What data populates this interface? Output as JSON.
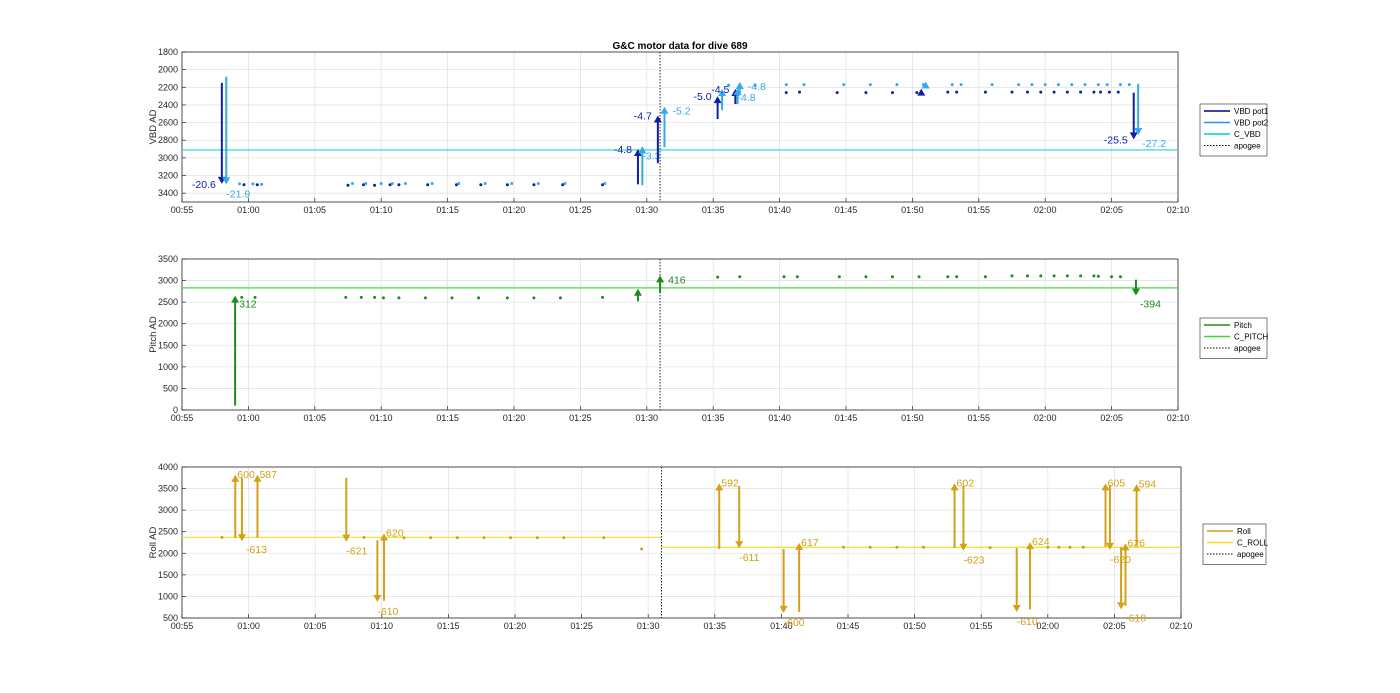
{
  "chart_data": [
    {
      "id": "vbd",
      "type": "line",
      "title": "G&C motor data for dive 689",
      "ylabel": "VBD AD",
      "ylim": [
        1800,
        3500
      ],
      "yreverse": true,
      "yticks": [
        1800,
        2000,
        2200,
        2400,
        2600,
        2800,
        3000,
        3200,
        3400
      ],
      "xlim": [
        "00:55",
        "02:10"
      ],
      "xticks": [
        "00:55",
        "01:00",
        "01:05",
        "01:10",
        "01:15",
        "01:20",
        "01:25",
        "01:30",
        "01:35",
        "01:40",
        "01:45",
        "01:50",
        "01:55",
        "02:00",
        "02:05",
        "02:10"
      ],
      "grid": true,
      "legend": {
        "placement": "right",
        "entries": [
          {
            "name": "VBD pot1",
            "color": "#00008b",
            "style": "solid"
          },
          {
            "name": "VBD pot2",
            "color": "#1e90ff",
            "style": "solid"
          },
          {
            "name": "C_VBD",
            "color": "#00cdcd",
            "style": "solid"
          },
          {
            "name": "apogee",
            "color": "#000000",
            "style": "dotted"
          }
        ]
      },
      "reference_line": {
        "name": "C_VBD",
        "y": 2910,
        "color": "#22d3d3"
      },
      "apogee_x": "01:31",
      "series": [
        {
          "name": "VBD pot1",
          "color": "#1020a0",
          "x": [
            "00:59:40",
            "01:00:40",
            "01:07:30",
            "01:08:40",
            "01:09:30",
            "01:10:40",
            "01:11:20",
            "01:13:30",
            "01:15:40",
            "01:17:30",
            "01:19:30",
            "01:21:30",
            "01:23:40",
            "01:26:40",
            "01:35:40",
            "01:36:50",
            "01:40:30",
            "01:41:30",
            "01:44:20",
            "01:46:30",
            "01:48:30",
            "01:50:20",
            "01:52:40",
            "01:53:20",
            "01:55:30",
            "01:57:30",
            "01:58:40",
            "01:59:40",
            "02:00:40",
            "02:01:40",
            "02:02:40",
            "02:03:40",
            "02:04:10",
            "02:04:50",
            "02:05:30"
          ],
          "values": [
            3305,
            3305,
            3310,
            3305,
            3310,
            3305,
            3305,
            3305,
            3305,
            3305,
            3305,
            3305,
            3305,
            3305,
            2255,
            2255,
            2260,
            2255,
            2260,
            2260,
            2260,
            2260,
            2255,
            2255,
            2255,
            2255,
            2255,
            2255,
            2255,
            2255,
            2255,
            2255,
            2255,
            2255,
            2255
          ]
        },
        {
          "name": "VBD pot2",
          "color": "#33aaee",
          "x": [
            "00:59:20",
            "01:00:20",
            "01:01:00",
            "01:07:50",
            "01:08:50",
            "01:10:00",
            "01:10:50",
            "01:11:50",
            "01:13:50",
            "01:15:50",
            "01:17:50",
            "01:19:50",
            "01:21:50",
            "01:23:50",
            "01:26:50",
            "01:36:10",
            "01:38:10",
            "01:40:30",
            "01:41:50",
            "01:44:50",
            "01:46:50",
            "01:48:50",
            "01:50:50",
            "01:53:00",
            "01:53:40",
            "01:56:00",
            "01:58:00",
            "01:59:00",
            "02:00:00",
            "02:01:00",
            "02:02:00",
            "02:03:00",
            "02:04:00",
            "02:04:40",
            "02:05:40",
            "02:06:20"
          ],
          "values": [
            3295,
            3295,
            3300,
            3290,
            3290,
            3290,
            3290,
            3290,
            3290,
            3290,
            3290,
            3290,
            3290,
            3290,
            3290,
            2175,
            2180,
            2170,
            2170,
            2170,
            2170,
            2170,
            2170,
            2170,
            2170,
            2170,
            2170,
            2170,
            2170,
            2170,
            2170,
            2170,
            2170,
            2170,
            2170,
            2170
          ]
        }
      ],
      "arrows": [
        {
          "x": "00:58:00",
          "y_from": 2150,
          "y_to": 3295,
          "color": "#1020a0",
          "label": "-20.6",
          "label_side": "left"
        },
        {
          "x": "00:58:20",
          "y_from": 2080,
          "y_to": 3300,
          "color": "#33aaee",
          "label": "-21.9",
          "label_side": "below"
        },
        {
          "x": "01:29:20",
          "y_from": 3300,
          "y_to": 2900,
          "color": "#1020a0",
          "label": "-4.8",
          "label_side": "left"
        },
        {
          "x": "01:29:40",
          "y_from": 3310,
          "y_to": 2870,
          "color": "#33aaee",
          "label": "-3.3",
          "label_side": "below"
        },
        {
          "x": "01:30:50",
          "y_from": 3060,
          "y_to": 2520,
          "color": "#1020a0",
          "label": "-4.7",
          "label_side": "left"
        },
        {
          "x": "01:31:20",
          "y_from": 2880,
          "y_to": 2420,
          "color": "#33aaee",
          "label": "-5.2",
          "label_side": "right"
        },
        {
          "x": "01:35:20",
          "y_from": 2560,
          "y_to": 2300,
          "color": "#1020a0",
          "label": "-5.0",
          "label_side": "left"
        },
        {
          "x": "01:35:40",
          "y_from": 2460,
          "y_to": 2220,
          "color": "#33aaee",
          "label": "",
          "label_side": "none"
        },
        {
          "x": "01:36:40",
          "y_from": 2390,
          "y_to": 2220,
          "color": "#1020a0",
          "label": "-4.5",
          "label_side": "left"
        },
        {
          "x": "01:36:50",
          "y_from": 2390,
          "y_to": 2210,
          "color": "#33aaee",
          "label": "-4.8",
          "label_side": "below"
        },
        {
          "x": "01:37:00",
          "y_from": 2270,
          "y_to": 2140,
          "color": "#33aaee",
          "label": "-4.8",
          "label_side": "right"
        },
        {
          "x": "01:50:40",
          "y_from": 2240,
          "y_to": 2215,
          "color": "#1020a0",
          "label": "",
          "label_side": "none"
        },
        {
          "x": "01:51:00",
          "y_from": 2170,
          "y_to": 2135,
          "color": "#33aaee",
          "label": "",
          "label_side": "none"
        },
        {
          "x": "02:06:40",
          "y_from": 2260,
          "y_to": 2790,
          "color": "#1020a0",
          "label": "-25.5",
          "label_side": "left"
        },
        {
          "x": "02:07:00",
          "y_from": 2160,
          "y_to": 2740,
          "color": "#33aaee",
          "label": "-27.2",
          "label_side": "below-right"
        }
      ]
    },
    {
      "id": "pitch",
      "type": "line",
      "title": "",
      "ylabel": "Pitch AD",
      "ylim": [
        0,
        3500
      ],
      "yreverse": false,
      "yticks": [
        0,
        500,
        1000,
        1500,
        2000,
        2500,
        3000,
        3500
      ],
      "xlim": [
        "00:55",
        "02:10"
      ],
      "xticks": [
        "00:55",
        "01:00",
        "01:05",
        "01:10",
        "01:15",
        "01:20",
        "01:25",
        "01:30",
        "01:35",
        "01:40",
        "01:45",
        "01:50",
        "01:55",
        "02:00",
        "02:05",
        "02:10"
      ],
      "grid": true,
      "legend": {
        "placement": "right",
        "entries": [
          {
            "name": "Pitch",
            "color": "#1f8a1f",
            "style": "solid"
          },
          {
            "name": "C_PITCH",
            "color": "#33dd33",
            "style": "solid"
          },
          {
            "name": "apogee",
            "color": "#000000",
            "style": "dotted"
          }
        ]
      },
      "reference_line": {
        "name": "C_PITCH",
        "y": 2830,
        "color": "#44dd44"
      },
      "apogee_x": "01:31",
      "series": [
        {
          "name": "Pitch",
          "color": "#1f8a1f",
          "x": [
            "00:59:30",
            "01:00:30",
            "01:07:20",
            "01:08:30",
            "01:09:30",
            "01:10:10",
            "01:11:20",
            "01:13:20",
            "01:15:20",
            "01:17:20",
            "01:19:30",
            "01:21:30",
            "01:23:30",
            "01:26:40",
            "01:35:20",
            "01:37:00",
            "01:40:20",
            "01:41:20",
            "01:44:30",
            "01:46:30",
            "01:48:30",
            "01:50:30",
            "01:52:40",
            "01:53:20",
            "01:55:30",
            "01:57:30",
            "01:58:40",
            "01:59:40",
            "02:00:40",
            "02:01:40",
            "02:02:40",
            "02:03:40",
            "02:04:00",
            "02:05:00",
            "02:05:40"
          ],
          "values": [
            2610,
            2610,
            2610,
            2610,
            2610,
            2600,
            2600,
            2600,
            2600,
            2600,
            2600,
            2600,
            2600,
            2610,
            3080,
            3090,
            3090,
            3090,
            3090,
            3090,
            3090,
            3090,
            3090,
            3090,
            3090,
            3110,
            3110,
            3110,
            3110,
            3110,
            3110,
            3110,
            3100,
            3090,
            3090
          ]
        }
      ],
      "arrows": [
        {
          "x": "00:59:00",
          "y_from": 100,
          "y_to": 2650,
          "color": "#1f8a1f",
          "label": "312",
          "label_side": "below-right"
        },
        {
          "x": "01:29:20",
          "y_from": 2520,
          "y_to": 2810,
          "color": "#1f8a1f",
          "label": "",
          "label_side": "none"
        },
        {
          "x": "01:31:00",
          "y_from": 2720,
          "y_to": 3120,
          "color": "#1f8a1f",
          "label": "416",
          "label_side": "right"
        },
        {
          "x": "02:06:50",
          "y_from": 3020,
          "y_to": 2650,
          "color": "#1f8a1f",
          "label": "-394",
          "label_side": "below-right"
        }
      ]
    },
    {
      "id": "roll",
      "type": "line",
      "title": "",
      "ylabel": "Roll AD",
      "ylim": [
        500,
        4000
      ],
      "yreverse": false,
      "yticks": [
        500,
        1000,
        1500,
        2000,
        2500,
        3000,
        3500,
        4000
      ],
      "xlim": [
        "00:55",
        "02:10"
      ],
      "xticks": [
        "00:55",
        "01:00",
        "01:05",
        "01:10",
        "01:15",
        "01:20",
        "01:25",
        "01:30",
        "01:35",
        "01:40",
        "01:45",
        "01:50",
        "01:55",
        "02:00",
        "02:05",
        "02:10"
      ],
      "grid": true,
      "legend": {
        "placement": "right",
        "entries": [
          {
            "name": "Roll",
            "color": "#d4a017",
            "style": "solid"
          },
          {
            "name": "C_ROLL",
            "color": "#f0e020",
            "style": "solid"
          },
          {
            "name": "apogee",
            "color": "#000000",
            "style": "dotted"
          }
        ]
      },
      "reference_segments": [
        {
          "x_from": "00:55",
          "x_to": "01:31",
          "y": 2370,
          "color": "#e8e030"
        },
        {
          "x_from": "01:31",
          "x_to": "02:10",
          "y": 2140,
          "color": "#e8e030"
        }
      ],
      "apogee_x": "01:31",
      "series": [
        {
          "name": "Roll",
          "color": "#d4a017",
          "x": [
            "00:58:00",
            "01:08:40",
            "01:11:40",
            "01:13:40",
            "01:15:40",
            "01:17:40",
            "01:19:40",
            "01:21:40",
            "01:23:40",
            "01:26:40",
            "01:29:30",
            "01:44:40",
            "01:46:40",
            "01:48:40",
            "01:50:40",
            "01:55:40",
            "02:00:00",
            "02:00:50",
            "02:01:40",
            "02:02:40"
          ],
          "values": [
            2370,
            2370,
            2360,
            2360,
            2360,
            2360,
            2360,
            2360,
            2360,
            2360,
            2100,
            2140,
            2140,
            2140,
            2140,
            2130,
            2140,
            2140,
            2140,
            2140
          ]
        }
      ],
      "arrows": [
        {
          "x": "00:59:00",
          "y_from": 2350,
          "y_to": 3820,
          "color": "#d4a017",
          "label": "600",
          "label_side": "right-top"
        },
        {
          "x": "00:59:30",
          "y_from": 3750,
          "y_to": 2280,
          "color": "#d4a017",
          "label": "-613",
          "label_side": "below-right"
        },
        {
          "x": "01:00:40",
          "y_from": 2360,
          "y_to": 3820,
          "color": "#d4a017",
          "label": "587",
          "label_side": "right-top"
        },
        {
          "x": "01:07:20",
          "y_from": 3750,
          "y_to": 2270,
          "color": "#d4a017",
          "label": "-621",
          "label_side": "below"
        },
        {
          "x": "01:09:40",
          "y_from": 2300,
          "y_to": 870,
          "color": "#d4a017",
          "label": "-610",
          "label_side": "below"
        },
        {
          "x": "01:10:10",
          "y_from": 900,
          "y_to": 2460,
          "color": "#d4a017",
          "label": "620",
          "label_side": "right-top"
        },
        {
          "x": "01:35:20",
          "y_from": 2100,
          "y_to": 3620,
          "color": "#d4a017",
          "label": "592",
          "label_side": "right-top"
        },
        {
          "x": "01:36:50",
          "y_from": 3560,
          "y_to": 2120,
          "color": "#d4a017",
          "label": "-611",
          "label_side": "below"
        },
        {
          "x": "01:40:10",
          "y_from": 2100,
          "y_to": 620,
          "color": "#d4a017",
          "label": "-600",
          "label_side": "below"
        },
        {
          "x": "01:41:20",
          "y_from": 640,
          "y_to": 2240,
          "color": "#d4a017",
          "label": "617",
          "label_side": "right-top"
        },
        {
          "x": "01:53:00",
          "y_from": 2120,
          "y_to": 3620,
          "color": "#d4a017",
          "label": "602",
          "label_side": "right-top"
        },
        {
          "x": "01:53:40",
          "y_from": 3560,
          "y_to": 2060,
          "color": "#d4a017",
          "label": "-623",
          "label_side": "below"
        },
        {
          "x": "01:57:40",
          "y_from": 2120,
          "y_to": 640,
          "color": "#d4a017",
          "label": "-610",
          "label_side": "below"
        },
        {
          "x": "01:58:40",
          "y_from": 700,
          "y_to": 2260,
          "color": "#d4a017",
          "label": "624",
          "label_side": "right-top"
        },
        {
          "x": "02:04:20",
          "y_from": 2150,
          "y_to": 3620,
          "color": "#d4a017",
          "label": "605",
          "label_side": "right-top"
        },
        {
          "x": "02:04:40",
          "y_from": 3580,
          "y_to": 2080,
          "color": "#d4a017",
          "label": "-620",
          "label_side": "below"
        },
        {
          "x": "02:05:30",
          "y_from": 2140,
          "y_to": 700,
          "color": "#d4a017",
          "label": "-610",
          "label_side": "below-right"
        },
        {
          "x": "02:05:50",
          "y_from": 780,
          "y_to": 2230,
          "color": "#d4a017",
          "label": "626",
          "label_side": "right-top"
        },
        {
          "x": "02:06:40",
          "y_from": 2180,
          "y_to": 3600,
          "color": "#d4a017",
          "label": "594",
          "label_side": "right-top"
        }
      ]
    }
  ]
}
